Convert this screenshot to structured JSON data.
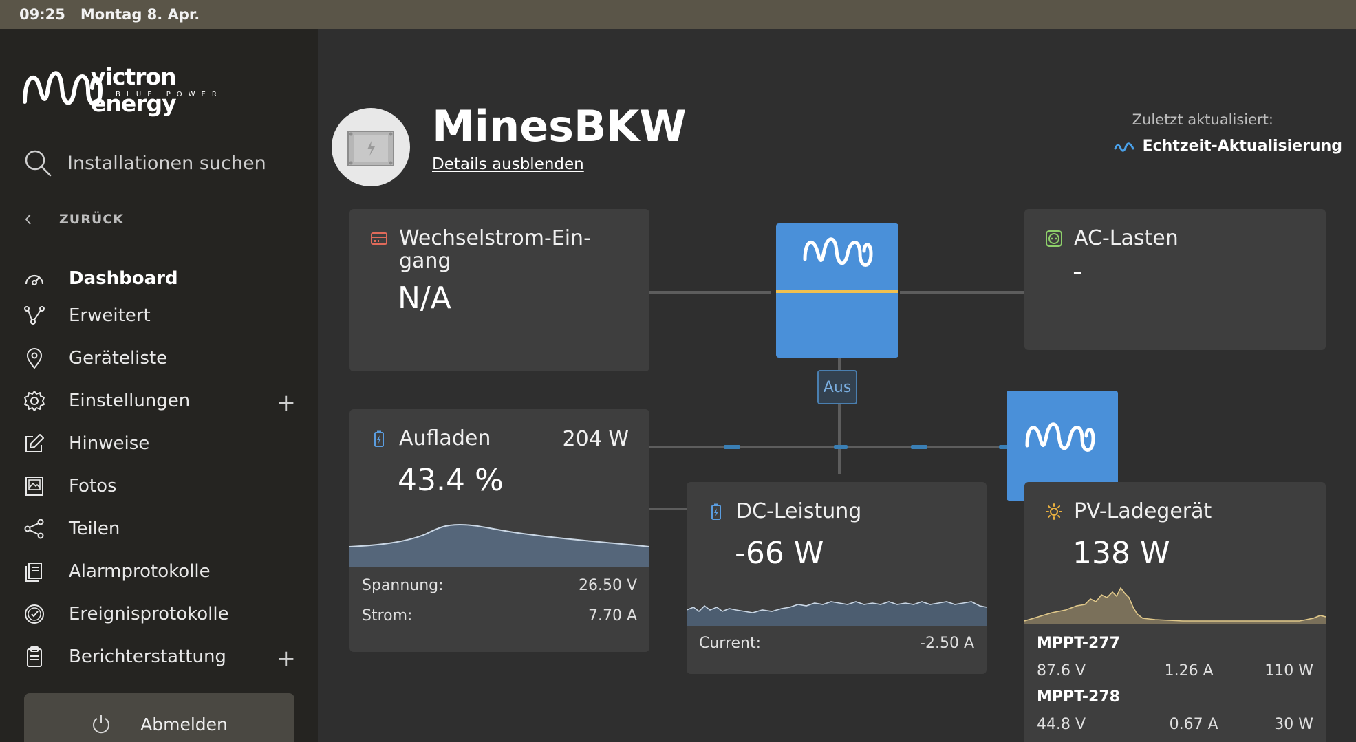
{
  "status_bar": {
    "time": "09:25",
    "date": "Montag 8. Apr."
  },
  "sidebar": {
    "search_placeholder": "Installationen suchen",
    "back_label": "ZURÜCK",
    "items": [
      {
        "label": "Dashboard",
        "icon": "gauge-icon",
        "active": true
      },
      {
        "label": "Erweitert",
        "icon": "graph-nodes-icon"
      },
      {
        "label": "Geräteliste",
        "icon": "map-pin-icon"
      },
      {
        "label": "Einstellungen",
        "icon": "gear-icon",
        "expandable": true
      },
      {
        "label": "Hinweise",
        "icon": "edit-icon"
      },
      {
        "label": "Fotos",
        "icon": "photo-icon"
      },
      {
        "label": "Teilen",
        "icon": "share-icon"
      },
      {
        "label": "Alarmprotokolle",
        "icon": "alarm-log-icon"
      },
      {
        "label": "Ereignisprotokolle",
        "icon": "clock-icon"
      },
      {
        "label": "Berichterstattung",
        "icon": "clipboard-icon",
        "expandable": true
      }
    ],
    "logout_label": "Abmelden"
  },
  "header": {
    "title": "MinesBKW",
    "details_link": "Details ausblenden",
    "updated_label": "Zuletzt aktualisiert:",
    "updated_value": "Echtzeit-Aktualisierung"
  },
  "cards": {
    "ac_input": {
      "title": "Wechselstrom-Ein- gang",
      "title_line1": "Wechselstrom-Ein-",
      "title_line2": "gang",
      "value": "N/A"
    },
    "ac_loads": {
      "title": "AC-Lasten",
      "value": "-"
    },
    "battery": {
      "title": "Aufladen",
      "power": "204 W",
      "soc": "43.4 %",
      "voltage_label": "Spannung:",
      "voltage": "26.50 V",
      "current_label": "Strom:",
      "current": "7.70 A"
    },
    "dc_power": {
      "title": "DC-Leistung",
      "value": "-66 W",
      "current_label": "Current:",
      "current": "-2.50 A"
    },
    "pv_charger": {
      "title": "PV-Ladegerät",
      "value": "138 W",
      "mppts": [
        {
          "name": "MPPT-277",
          "voltage": "87.6 V",
          "current": "1.26 A",
          "power": "110 W"
        },
        {
          "name": "MPPT-278",
          "voltage": "44.8 V",
          "current": "0.67 A",
          "power": "30 W"
        }
      ]
    }
  },
  "inverter_badge": "Aus",
  "colors": {
    "inverter_blue": "#4a90d9",
    "ac_input_icon": "#e06a5a",
    "ac_loads_icon": "#8ecf6a",
    "battery_icon": "#5a9de0",
    "pv_icon": "#e8b040",
    "live_icon": "#4aa0e8"
  }
}
